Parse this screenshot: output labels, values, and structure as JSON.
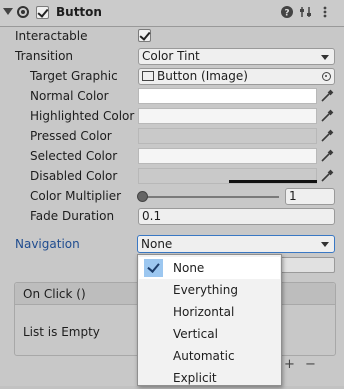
{
  "component": {
    "title": "Button",
    "enabled": true
  },
  "properties": {
    "interactable_label": "Interactable",
    "interactable_checked": true,
    "transition_label": "Transition",
    "transition_value": "Color Tint",
    "target_graphic_label": "Target Graphic",
    "target_graphic_value": "Button (Image)",
    "normal_color_label": "Normal Color",
    "highlighted_color_label": "Highlighted Color",
    "pressed_color_label": "Pressed Color",
    "selected_color_label": "Selected Color",
    "disabled_color_label": "Disabled Color",
    "color_multiplier_label": "Color Multiplier",
    "color_multiplier_value": "1",
    "color_multiplier_slider_fraction": 0,
    "fade_duration_label": "Fade Duration",
    "fade_duration_value": "0.1",
    "navigation_label": "Navigation",
    "navigation_value": "None"
  },
  "colors": {
    "normal": "#ffffff",
    "highlighted": "#f5f5f5",
    "pressed": "#c8c8c8",
    "selected": "#f5f5f5",
    "disabled": "#c8c8c8",
    "navigation_label": "#1f4c8f",
    "selected_option_highlight": "#9cc7f0"
  },
  "on_click": {
    "title": "On Click ()",
    "empty_text": "List is Empty",
    "add_symbol": "+",
    "remove_symbol": "−"
  },
  "navigation_dropdown": {
    "options": [
      {
        "label": "None",
        "selected": true
      },
      {
        "label": "Everything",
        "selected": false
      },
      {
        "label": "Horizontal",
        "selected": false
      },
      {
        "label": "Vertical",
        "selected": false
      },
      {
        "label": "Automatic",
        "selected": false
      },
      {
        "label": "Explicit",
        "selected": false
      }
    ]
  },
  "header_icons": [
    "help-icon",
    "preset-icon",
    "more-options-icon"
  ]
}
